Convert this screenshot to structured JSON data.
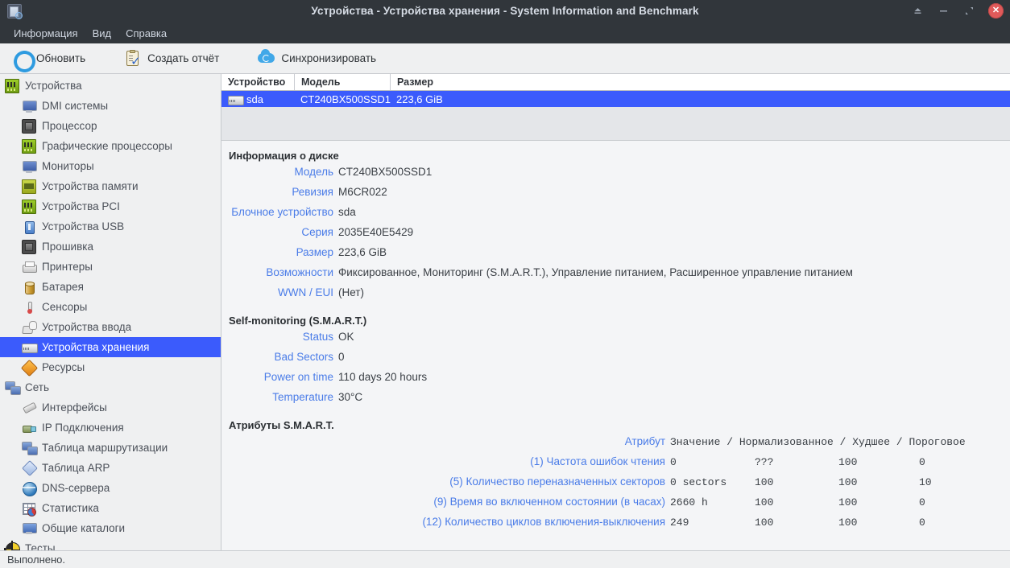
{
  "window": {
    "title": "Устройства - Устройства хранения - System Information and Benchmark",
    "app_icon": "app-icon",
    "controls": {
      "shade": "shade-icon",
      "minimize": "minimize-icon",
      "maximize": "maximize-icon",
      "close": "✕"
    }
  },
  "menubar": {
    "items": [
      {
        "label": "Информация"
      },
      {
        "label": "Вид"
      },
      {
        "label": "Справка"
      }
    ]
  },
  "toolbar": {
    "buttons": [
      {
        "label": "Обновить",
        "icon": "refresh-icon"
      },
      {
        "label": "Создать отчёт",
        "icon": "report-icon"
      },
      {
        "label": "Синхронизировать",
        "icon": "sync-icon"
      }
    ]
  },
  "sidebar": {
    "items": [
      {
        "label": "Устройства",
        "icon": "devices-card-icon",
        "level": 0,
        "selected": false
      },
      {
        "label": "DMI системы",
        "icon": "monitor-icon",
        "level": 1,
        "selected": false
      },
      {
        "label": "Процессор",
        "icon": "cpu-chip-icon",
        "level": 1,
        "selected": false
      },
      {
        "label": "Графические процессоры",
        "icon": "gpu-card-icon",
        "level": 1,
        "selected": false
      },
      {
        "label": "Мониторы",
        "icon": "monitor-icon",
        "level": 1,
        "selected": false
      },
      {
        "label": "Устройства памяти",
        "icon": "memory-icon",
        "level": 1,
        "selected": false
      },
      {
        "label": "Устройства PCI",
        "icon": "pci-card-icon",
        "level": 1,
        "selected": false
      },
      {
        "label": "Устройства USB",
        "icon": "usb-icon",
        "level": 1,
        "selected": false
      },
      {
        "label": "Прошивка",
        "icon": "firmware-chip-icon",
        "level": 1,
        "selected": false
      },
      {
        "label": "Принтеры",
        "icon": "printer-icon",
        "level": 1,
        "selected": false
      },
      {
        "label": "Батарея",
        "icon": "battery-icon",
        "level": 1,
        "selected": false
      },
      {
        "label": "Сенсоры",
        "icon": "thermometer-icon",
        "level": 1,
        "selected": false
      },
      {
        "label": "Устройства ввода",
        "icon": "input-device-icon",
        "level": 1,
        "selected": false
      },
      {
        "label": "Устройства хранения",
        "icon": "harddisk-icon",
        "level": 1,
        "selected": true
      },
      {
        "label": "Ресурсы",
        "icon": "resources-icon",
        "level": 1,
        "selected": false
      },
      {
        "label": "Сеть",
        "icon": "network-icon",
        "level": 0,
        "selected": false
      },
      {
        "label": "Интерфейсы",
        "icon": "interface-icon",
        "level": 1,
        "selected": false
      },
      {
        "label": "IP Подключения",
        "icon": "plug-icon",
        "level": 1,
        "selected": false
      },
      {
        "label": "Таблица маршрутизации",
        "icon": "network-icon",
        "level": 1,
        "selected": false
      },
      {
        "label": "Таблица ARP",
        "icon": "arp-diamond-icon",
        "level": 1,
        "selected": false
      },
      {
        "label": "DNS-сервера",
        "icon": "globe-icon",
        "level": 1,
        "selected": false
      },
      {
        "label": "Статистика",
        "icon": "statistics-icon",
        "level": 1,
        "selected": false
      },
      {
        "label": "Общие каталоги",
        "icon": "shared-folder-icon",
        "level": 1,
        "selected": false
      },
      {
        "label": "Тесты",
        "icon": "tests-icon",
        "level": 0,
        "selected": false
      }
    ]
  },
  "device_list": {
    "columns": [
      "Устройство",
      "Модель",
      "Размер"
    ],
    "rows": [
      {
        "device": "sda",
        "model": "CT240BX500SSD1",
        "size": "223,6 GiB",
        "icon": "harddisk-icon",
        "selected": true
      }
    ]
  },
  "disk_info": {
    "title": "Информация о диске",
    "fields": [
      {
        "key": "Модель",
        "value": "CT240BX500SSD1"
      },
      {
        "key": "Ревизия",
        "value": "M6CR022"
      },
      {
        "key": "Блочное устройство",
        "value": "sda"
      },
      {
        "key": "Серия",
        "value": "2035E40E5429"
      },
      {
        "key": "Размер",
        "value": "223,6 GiB"
      },
      {
        "key": "Возможности",
        "value": "Фиксированное, Мониторинг (S.M.A.R.T.), Управление питанием, Расширенное управление питанием"
      },
      {
        "key": "WWN / EUI",
        "value": "(Нет)"
      }
    ]
  },
  "smart_status": {
    "title": "Self-monitoring (S.M.A.R.T.)",
    "fields": [
      {
        "key": "Status",
        "value": "OK"
      },
      {
        "key": "Bad Sectors",
        "value": "0"
      },
      {
        "key": "Power on time",
        "value": "110 days 20 hours"
      },
      {
        "key": "Temperature",
        "value": "30°C"
      }
    ]
  },
  "smart_attributes": {
    "title": "Атрибуты S.M.A.R.T.",
    "header_name": "Атрибут",
    "header_cols": "Значение / Нормализованное / Худшее / Пороговое",
    "rows": [
      {
        "name": "(1) Частота ошибок чтения",
        "value": "0",
        "normalized": "???",
        "worst": "100",
        "threshold": "0"
      },
      {
        "name": "(5) Количество переназначенных секторов",
        "value": "0 sectors",
        "normalized": "100",
        "worst": "100",
        "threshold": "10"
      },
      {
        "name": "(9) Время во включенном состоянии (в часах)",
        "value": "2660 h",
        "normalized": "100",
        "worst": "100",
        "threshold": "0"
      },
      {
        "name": "(12) Количество циклов включения-выключения",
        "value": "249",
        "normalized": "100",
        "worst": "100",
        "threshold": "0"
      }
    ]
  },
  "statusbar": {
    "text": "Выполнено."
  },
  "colors": {
    "titlebar_bg": "#31363b",
    "selection_blue": "#3b5bfc",
    "key_label_blue": "#4a7ce8",
    "close_red": "#e05a5a",
    "content_bg": "#f4f5f7"
  }
}
